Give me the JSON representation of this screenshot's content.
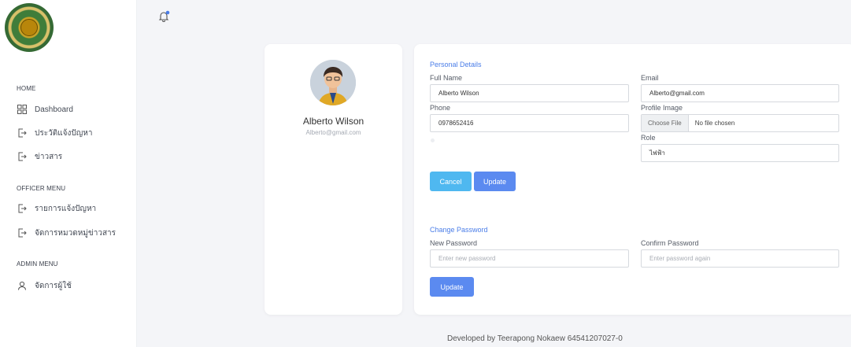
{
  "sidebar": {
    "logo_name": "government-seal-logo",
    "sections": [
      {
        "label": "HOME",
        "items": [
          "Dashboard",
          "ประวัติแจ้งปัญหา",
          "ข่าวสาร"
        ]
      },
      {
        "label": "OFFICER MENU",
        "items": [
          "รายการแจ้งปัญหา",
          "จัดการหมวดหมู่ข่าวสาร"
        ]
      },
      {
        "label": "ADMIN MENU",
        "items": [
          "จัดการผู้ใช้"
        ]
      }
    ]
  },
  "header": {
    "notification_icon": "bell-icon",
    "notification_dot_color": "#4a7de8"
  },
  "profile": {
    "name": "Alberto Wilson",
    "email": "Alberto@gmail.com"
  },
  "personal": {
    "title": "Personal Details",
    "full_name_label": "Full Name",
    "full_name_value": "Alberto Wilson",
    "email_label": "Email",
    "email_value": "Alberto@gmail.com",
    "phone_label": "Phone",
    "phone_value": "0978652416",
    "profile_image_label": "Profile Image",
    "choose_file": "Choose File",
    "no_file": "No file chosen",
    "role_label": "Role",
    "role_value": "ไฟฟ้า",
    "cancel_label": "Cancel",
    "update_label": "Update"
  },
  "password": {
    "title": "Change Password",
    "new_label": "New Password",
    "new_placeholder": "Enter new password",
    "confirm_label": "Confirm Password",
    "confirm_placeholder": "Enter password again",
    "update_label": "Update"
  },
  "footer": {
    "text": "Developed by Teerapong Nokaew 64541207027-0"
  },
  "colors": {
    "primary": "#5b8af0",
    "cancel": "#4fb8f0",
    "accent_text": "#4a7de8"
  }
}
